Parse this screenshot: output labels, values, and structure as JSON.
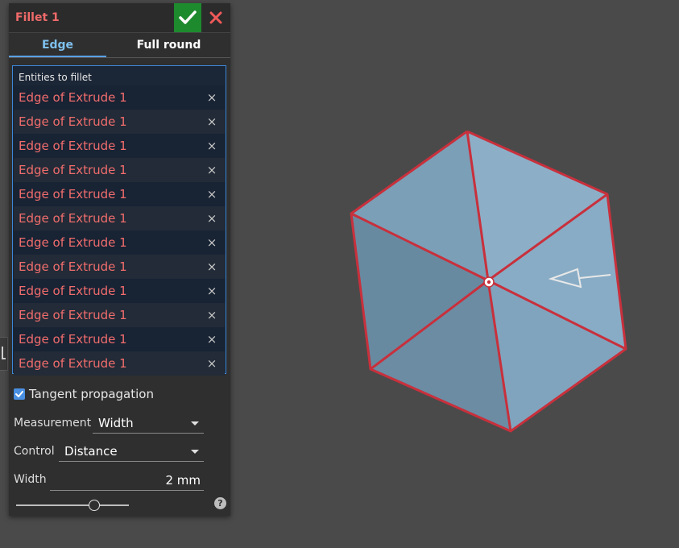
{
  "panel": {
    "title": "Fillet 1",
    "tabs": [
      {
        "label": "Edge",
        "active": true
      },
      {
        "label": "Full round",
        "active": false
      }
    ],
    "entities": {
      "label": "Entities to fillet",
      "items": [
        {
          "label": "Edge of Extrude 1",
          "remove": "×"
        },
        {
          "label": "Edge of Extrude 1",
          "remove": "×"
        },
        {
          "label": "Edge of Extrude 1",
          "remove": "×"
        },
        {
          "label": "Edge of Extrude 1",
          "remove": "×"
        },
        {
          "label": "Edge of Extrude 1",
          "remove": "×"
        },
        {
          "label": "Edge of Extrude 1",
          "remove": "×"
        },
        {
          "label": "Edge of Extrude 1",
          "remove": "×"
        },
        {
          "label": "Edge of Extrude 1",
          "remove": "×"
        },
        {
          "label": "Edge of Extrude 1",
          "remove": "×"
        },
        {
          "label": "Edge of Extrude 1",
          "remove": "×"
        },
        {
          "label": "Edge of Extrude 1",
          "remove": "×"
        },
        {
          "label": "Edge of Extrude 1",
          "remove": "×"
        }
      ]
    },
    "tangent_propagation": {
      "label": "Tangent propagation",
      "checked": true
    },
    "measurement": {
      "label": "Measurement",
      "value": "Width"
    },
    "control": {
      "label": "Control",
      "value": "Distance"
    },
    "width": {
      "label": "Width",
      "value": "2 mm"
    },
    "help": "?"
  },
  "colors": {
    "accent": "#5aa0e6",
    "error_text": "#f26d6d",
    "confirm": "#1e8a2e",
    "cancel": "#f05a5a",
    "cube_face": "#8db3cf",
    "edge_highlight": "#c8303c",
    "viewport_bg": "#4a4a4a"
  }
}
